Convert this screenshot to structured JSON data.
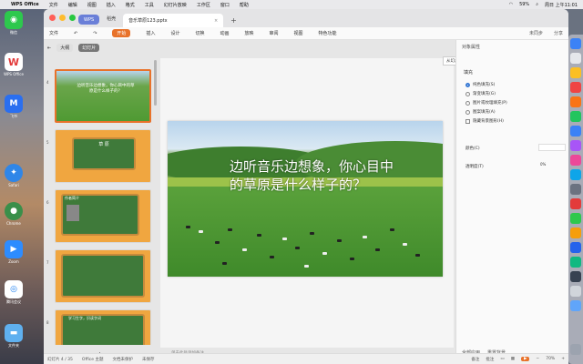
{
  "menubar": {
    "app": "WPS Office",
    "items": [
      "文件",
      "编辑",
      "视图",
      "插入",
      "格式",
      "工具",
      "幻灯片放映",
      "工作区",
      "窗口",
      "帮助"
    ],
    "battery": "59%",
    "clock": "周日 上午11:01"
  },
  "desktop": {
    "icons": [
      {
        "label": "微信",
        "icon": "wechat-icon",
        "color": "#2dc84d"
      },
      {
        "label": "WPS Office",
        "icon": "wps-icon",
        "color": "#e33b3b"
      },
      {
        "label": "飞书",
        "icon": "feishu-icon",
        "color": "#2a6ff0"
      },
      {
        "label": "Safari",
        "icon": "safari-icon",
        "color": "#2f86e8"
      },
      {
        "label": "Chrome",
        "icon": "chrome-icon",
        "color": "#3a8f4a"
      },
      {
        "label": "Zoom",
        "icon": "zoom-icon",
        "color": "#2d8cff"
      },
      {
        "label": "腾讯会议",
        "icon": "meeting-icon",
        "color": "#1a7ef0"
      },
      {
        "label": "文件夹",
        "icon": "folder-icon",
        "color": "#5fb0ef"
      }
    ]
  },
  "tabs": {
    "home": "WPS",
    "template": "稻壳",
    "doc": "音乐草原123.pptx"
  },
  "ribbon": {
    "menu": "文件",
    "items": [
      "开始",
      "插入",
      "设计",
      "切换",
      "动画",
      "放映",
      "审阅",
      "视图",
      "特色功能"
    ],
    "active": "开始",
    "right": [
      "未同步",
      "分享"
    ]
  },
  "thumbs": {
    "view_big": "大纲",
    "view_outline": "幻灯片",
    "slides": [
      {
        "num": "4",
        "title": "边听音乐边想象，你心目中的草原是什么样子的？",
        "selected": true
      },
      {
        "num": "5",
        "title": "草 原",
        "selected": false
      },
      {
        "num": "6",
        "title": "作者简介",
        "selected": false
      },
      {
        "num": "7",
        "title": "",
        "selected": false
      },
      {
        "num": "8",
        "title": "学习生字，识读字词",
        "selected": false
      }
    ]
  },
  "slide": {
    "title": "边听音乐边想象，你心目中的草原是什么样子的？"
  },
  "popup": "从幻灯片中更换",
  "notes_placeholder": "单击此处添加备注",
  "panel": {
    "title": "对象属性",
    "section": "填充",
    "options": [
      {
        "label": "纯色填充(S)",
        "type": "radio",
        "on": true
      },
      {
        "label": "渐变填充(G)",
        "type": "radio",
        "on": false
      },
      {
        "label": "图片或纹理填充(P)",
        "type": "radio",
        "on": false
      },
      {
        "label": "图案填充(A)",
        "type": "radio",
        "on": false
      },
      {
        "label": "隐藏背景图形(H)",
        "type": "check",
        "on": false
      }
    ],
    "color_label": "颜色(C)",
    "transparency_label": "透明度(T)",
    "transparency_value": "0%",
    "apply_all": "全部应用",
    "reset": "重置背景"
  },
  "status": {
    "slide_pos": "幻灯片 4 / 35",
    "theme": "Office 主题",
    "backup": "文档未保护",
    "autosave": "未保存",
    "notes": "备注",
    "comment": "批注",
    "zoom": "70%"
  }
}
